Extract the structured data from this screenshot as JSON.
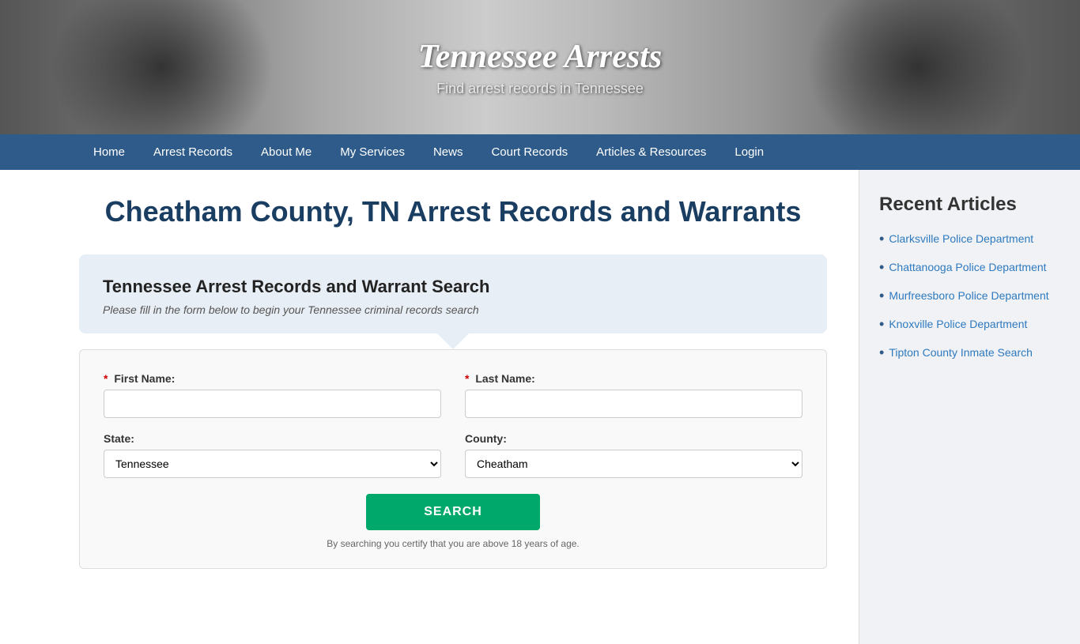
{
  "banner": {
    "title": "Tennessee Arrests",
    "subtitle": "Find arrest records in Tennessee"
  },
  "nav": {
    "items": [
      {
        "label": "Home",
        "active": false
      },
      {
        "label": "Arrest Records",
        "active": false
      },
      {
        "label": "About Me",
        "active": false
      },
      {
        "label": "My Services",
        "active": false
      },
      {
        "label": "News",
        "active": false
      },
      {
        "label": "Court Records",
        "active": false
      },
      {
        "label": "Articles & Resources",
        "active": false
      },
      {
        "label": "Login",
        "active": false
      }
    ]
  },
  "main": {
    "page_title": "Cheatham County, TN Arrest Records and Warrants",
    "search_box_title": "Tennessee Arrest Records and Warrant Search",
    "search_box_subtitle": "Please fill in the form below to begin your Tennessee criminal records search",
    "form": {
      "first_name_label": "First Name:",
      "last_name_label": "Last Name:",
      "state_label": "State:",
      "county_label": "County:",
      "state_value": "Tennessee",
      "county_value": "Cheatham",
      "search_button": "SEARCH",
      "form_note": "By searching you certify that you are above 18 years of age."
    }
  },
  "sidebar": {
    "title": "Recent Articles",
    "articles": [
      {
        "label": "Clarksville Police Department"
      },
      {
        "label": "Chattanooga Police Department"
      },
      {
        "label": "Murfreesboro Police Department"
      },
      {
        "label": "Knoxville Police Department"
      },
      {
        "label": "Tipton County Inmate Search"
      }
    ]
  }
}
